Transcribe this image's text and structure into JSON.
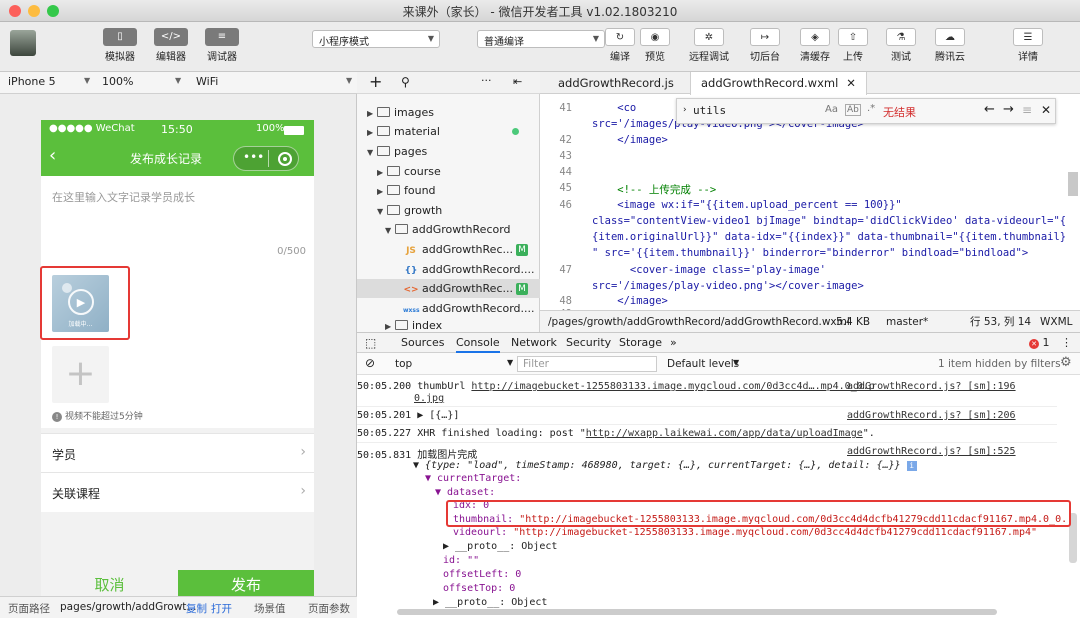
{
  "window": {
    "title": "来课外（家长） - 微信开发者工具 v1.02.1803210"
  },
  "toolbar": {
    "simulator": "模拟器",
    "editor": "编辑器",
    "debugger": "调试器",
    "mode_select": "小程序模式",
    "compile_select": "普通编译",
    "compile": "编译",
    "preview": "预览",
    "remote_debug": "远程调试",
    "switch_bg": "切后台",
    "clear_cache": "清缓存",
    "upload": "上传",
    "test": "测试",
    "tencent_cloud": "腾讯云",
    "details": "详情"
  },
  "simulator": {
    "device": "iPhone 5",
    "zoom": "100%",
    "network": "WiFi",
    "status_carrier": "●●●●● WeChat",
    "status_time": "15:50",
    "status_battery": "100%",
    "nav_title": "发布成长记录",
    "text_placeholder": "在这里输入文字记录学员成长",
    "char_count": "0/500",
    "video_note": "视频不能超过5分钟",
    "thumb_caption": "加载中…",
    "row_student": "学员",
    "row_course": "关联课程",
    "cancel": "取消",
    "publish": "发布"
  },
  "sim_footer": {
    "path_label": "页面路径",
    "path_value": "pages/growth/addGrowt...",
    "copy": "复制",
    "open": "打开",
    "scene": "场景值",
    "params": "页面参数"
  },
  "tree": {
    "items": [
      {
        "label": "images"
      },
      {
        "label": "material"
      },
      {
        "label": "pages"
      },
      {
        "label": "course"
      },
      {
        "label": "found"
      },
      {
        "label": "growth"
      },
      {
        "label": "addGrowthRecord"
      },
      {
        "label": "addGrowthRec...",
        "type": "JS"
      },
      {
        "label": "addGrowthRecord....",
        "type": "{}"
      },
      {
        "label": "addGrowthRec...",
        "type": "<>"
      },
      {
        "label": "addGrowthRecord....",
        "type": "wxss"
      },
      {
        "label": "index"
      }
    ]
  },
  "editor": {
    "tab1": "addGrowthRecord.js",
    "tab2": "addGrowthRecord.wxml",
    "find_value": "utils",
    "find_result": "无结果",
    "line_numbers": [
      "41",
      "",
      "42",
      "43",
      "44",
      "45",
      "46",
      "",
      "",
      "",
      "47",
      "",
      "48",
      "49"
    ],
    "code_lines": [
      "    <co",
      "src='/images/play-video.png'></cover-image>",
      "    </image>",
      "",
      "",
      "    <!-- 上传完成 -->",
      "    <image wx:if=\"{{item.upload_percent == 100}}\"",
      "class=\"contentView-video1 bjImage\" bindtap='didClickVideo' data-videourl=\"{",
      "{item.originalUrl}}\" data-idx=\"{{index}}\" data-thumbnail=\"{{item.thumbnail}}",
      "\" src='{{item.thumbnail}}' binderror=\"binderror\" bindload=\"bindload\">",
      "      <cover-image class='play-image'",
      "src='/images/play-video.png'></cover-image>",
      "    </image>"
    ],
    "status_path": "/pages/growth/addGrowthRecord/addGrowthRecord.wxml",
    "status_size": "5.4 KB",
    "status_branch": "master*",
    "status_pos": "行 53, 列 14",
    "status_lang": "WXML"
  },
  "devtools": {
    "tabs": [
      "Sources",
      "Console",
      "Network",
      "Security",
      "Storage"
    ],
    "more": "»",
    "error_count": "1",
    "context": "top",
    "filter_placeholder": "Filter",
    "levels": "Default levels",
    "hidden_note": "1 item hidden by filters"
  },
  "console": {
    "r1_time": "50:05.200",
    "r1_text": "thumbUrl ",
    "r1_link": "http://imagebucket-1255803133.image.myqcloud.com/0d3cc4d….mp4.0_0.p",
    "r1_link2": "0.jpg",
    "r1_src": "addGrowthRecord.js? [sm]:196",
    "r2_time": "50:05.201",
    "r2_text": "▶ [{…}]",
    "r2_src": "addGrowthRecord.js? [sm]:206",
    "r3_time": "50:05.227",
    "r3_text": "XHR finished loading: post \"",
    "r3_link": "http://wxapp.laikewai.com/app/data/uploadImage",
    "r3_end": "\".",
    "r4_time": "50:05.831",
    "r4_text": "加载图片完成",
    "r4_src": "addGrowthRecord.js? [sm]:525",
    "obj_line": "▼ {type: \"load\", timeStamp: 468980, target: {…}, currentTarget: {…}, detail: {…}}",
    "current_target": "▼ currentTarget:",
    "dataset": "▼ dataset:",
    "idx": "idx: 0",
    "thumbnail_key": "thumbnail:",
    "thumbnail_val": "\"http://imagebucket-1255803133.image.myqcloud.com/0d3cc4d4dcfb41279cdd11cdacf91167.mp4.0_0.p0.jpg\"",
    "videourl_key": "videourl:",
    "videourl_val": "\"http://imagebucket-1255803133.image.myqcloud.com/0d3cc4d4dcfb41279cdd11cdacf91167.mp4\"",
    "proto1": "▶ __proto__: Object",
    "id": "id: \"\"",
    "offsetLeft": "offsetLeft: 0",
    "offsetTop": "offsetTop: 0",
    "proto2": "▶ __proto__: Object"
  },
  "colors": {
    "wechat_green": "#5bbf3c",
    "highlight_red": "#e53935"
  }
}
